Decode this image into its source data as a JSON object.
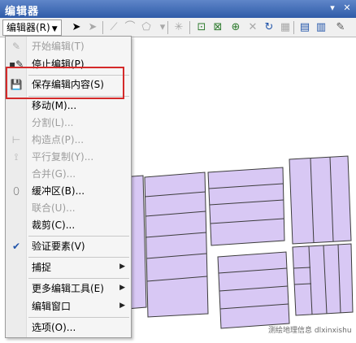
{
  "window": {
    "title": "编辑器"
  },
  "toolbar": {
    "editor_menu_label": "编辑器(R)"
  },
  "menu": {
    "items": [
      {
        "label": "开始编辑(T)"
      },
      {
        "label": "停止编辑(P)"
      },
      {
        "label": "保存编辑内容(S)"
      },
      {
        "label": "移动(M)..."
      },
      {
        "label": "分割(L)..."
      },
      {
        "label": "构造点(P)..."
      },
      {
        "label": "平行复制(Y)..."
      },
      {
        "label": "合并(G)..."
      },
      {
        "label": "缓冲区(B)..."
      },
      {
        "label": "联合(U)..."
      },
      {
        "label": "裁剪(C)..."
      },
      {
        "label": "验证要素(V)"
      },
      {
        "label": "捕捉"
      },
      {
        "label": "更多编辑工具(E)"
      },
      {
        "label": "编辑窗口"
      },
      {
        "label": "选项(O)..."
      }
    ]
  },
  "watermark": {
    "text": "测绘地理信息 dlxinxishu"
  },
  "colors": {
    "parcel_fill": "#d8c8f4",
    "parcel_stroke": "#3c3c3c",
    "highlight": "#d42a2a",
    "titlebar": "#3a64b0"
  }
}
